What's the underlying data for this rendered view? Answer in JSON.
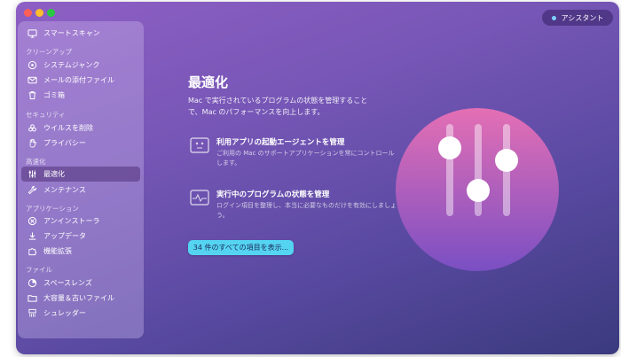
{
  "sidebar": {
    "top_item": {
      "label": "スマートスキャン",
      "icon": "monitor-icon"
    },
    "sections": [
      {
        "title": "クリーンアップ",
        "items": [
          {
            "label": "システムジャンク",
            "icon": "system-junk-icon"
          },
          {
            "label": "メールの添付ファイル",
            "icon": "mail-icon"
          },
          {
            "label": "ゴミ箱",
            "icon": "trash-icon"
          }
        ]
      },
      {
        "title": "セキュリティ",
        "items": [
          {
            "label": "ウイルスを削除",
            "icon": "biohazard-icon"
          },
          {
            "label": "プライバシー",
            "icon": "hand-icon"
          }
        ]
      },
      {
        "title": "高速化",
        "items": [
          {
            "label": "最適化",
            "icon": "sliders-icon",
            "active": true
          },
          {
            "label": "メンテナンス",
            "icon": "wrench-icon"
          }
        ]
      },
      {
        "title": "アプリケーション",
        "items": [
          {
            "label": "アンインストーラ",
            "icon": "uninstaller-icon"
          },
          {
            "label": "アップデータ",
            "icon": "updater-icon"
          },
          {
            "label": "機能拡張",
            "icon": "extensions-icon"
          }
        ]
      },
      {
        "title": "ファイル",
        "items": [
          {
            "label": "スペースレンズ",
            "icon": "space-lens-icon"
          },
          {
            "label": "大容量＆古いファイル",
            "icon": "folder-icon"
          },
          {
            "label": "シュレッダー",
            "icon": "shredder-icon"
          }
        ]
      }
    ]
  },
  "assistant": {
    "label": "アシスタント"
  },
  "main": {
    "title": "最適化",
    "description": "Mac で実行されているプログラムの状態を管理することで、Mac のパフォーマンスを向上します。",
    "features": [
      {
        "title": "利用アプリの起動エージェントを管理",
        "description": "ご利用の Mac のサポートアプリケーションを常にコントロールします。",
        "icon": "launch-agents-icon"
      },
      {
        "title": "実行中のプログラムの状態を管理",
        "description": "ログイン項目を整理し、本当に必要なものだけを有効にしましょう。",
        "icon": "activity-monitor-icon"
      }
    ],
    "cta_label": "34 件のすべての項目を表示..."
  },
  "colors": {
    "accent": "#55d4f2",
    "emblem_pink": "#e46fb4",
    "emblem_purple": "#7a4fc3"
  }
}
